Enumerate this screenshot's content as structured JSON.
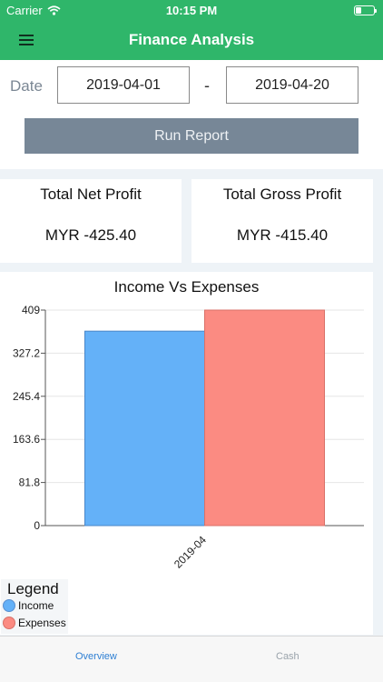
{
  "status_bar": {
    "carrier": "Carrier",
    "time": "10:15 PM"
  },
  "nav": {
    "title": "Finance Analysis"
  },
  "report": {
    "date_label": "Date",
    "date_from": "2019-04-01",
    "separator": "-",
    "date_to": "2019-04-20",
    "run_label": "Run Report"
  },
  "summary": {
    "net_label": "Total Net Profit",
    "net_value": "MYR -425.40",
    "gross_label": "Total Gross Profit",
    "gross_value": "MYR -415.40"
  },
  "chart_data": {
    "type": "bar",
    "title": "Income Vs Expenses",
    "categories": [
      "2019-04"
    ],
    "series": [
      {
        "name": "Income",
        "values": [
          369
        ],
        "color": "#64b1f8"
      },
      {
        "name": "Expenses",
        "values": [
          409
        ],
        "color": "#fb8b82"
      }
    ],
    "yticks": [
      "0",
      "81.8",
      "163.6",
      "245.4",
      "327.2",
      "409"
    ],
    "ylim": [
      0,
      409
    ],
    "legend": {
      "title": "Legend",
      "placement": "bottom-left"
    }
  },
  "tabs": [
    {
      "label": "Overview",
      "active": true
    },
    {
      "label": "Cash",
      "active": false
    }
  ],
  "colors": {
    "brand": "#2fb66a",
    "button": "#778797",
    "active_tab": "#2e7fd3"
  }
}
